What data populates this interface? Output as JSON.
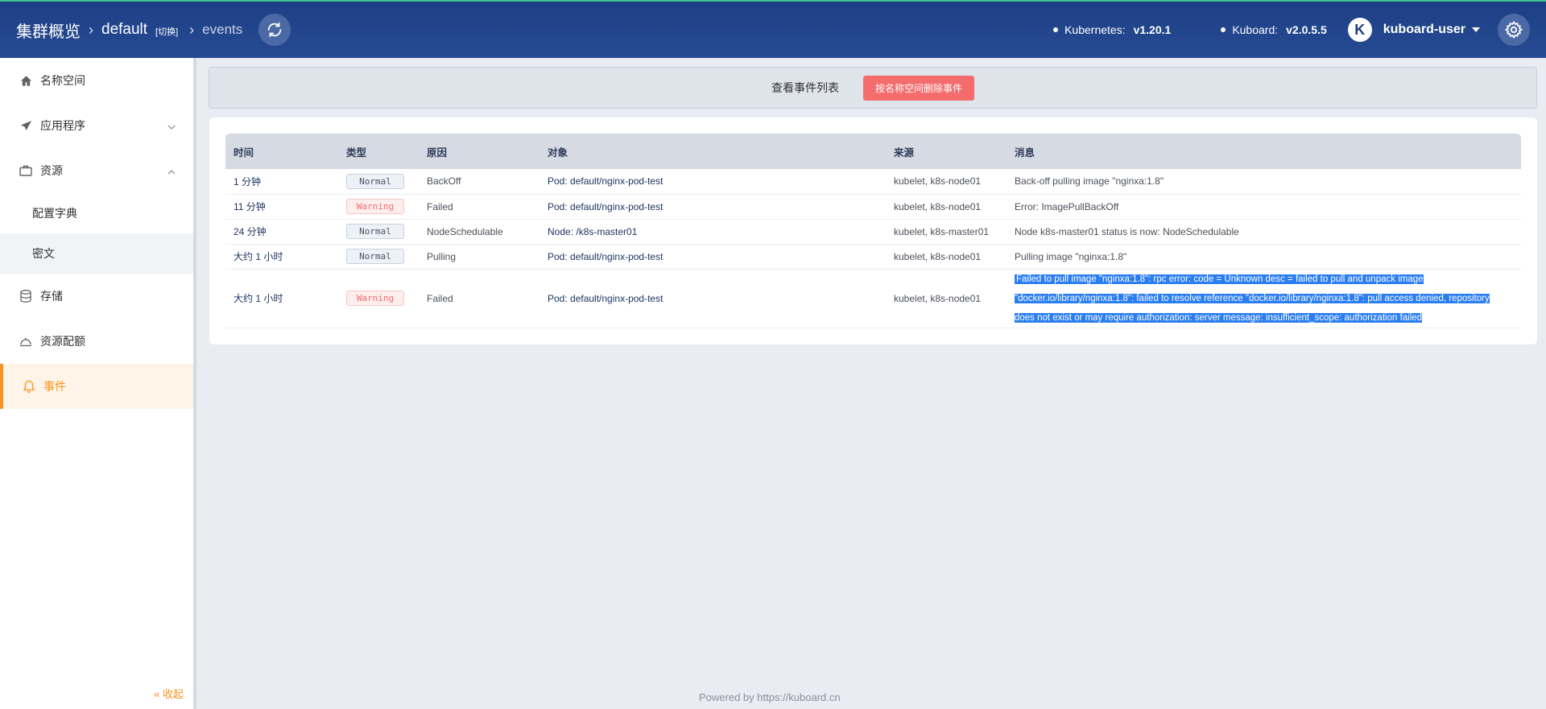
{
  "header": {
    "home": "集群概览",
    "namespace": "default",
    "switch": "[切换]",
    "page": "events",
    "kubernetes_label": "Kubernetes:",
    "kubernetes_version": "v1.20.1",
    "kuboard_label": "Kuboard:",
    "kuboard_version": "v2.0.5.5",
    "avatar_letter": "K",
    "user": "kuboard-user"
  },
  "sidebar": {
    "items": [
      {
        "label": "名称空间",
        "icon": "home-icon"
      },
      {
        "label": "应用程序",
        "icon": "send-icon"
      },
      {
        "label": "资源",
        "icon": "briefcase-icon"
      },
      {
        "label": "配置字典"
      },
      {
        "label": "密文"
      },
      {
        "label": "存储",
        "icon": "database-icon"
      },
      {
        "label": "资源配额",
        "icon": "quota-icon"
      },
      {
        "label": "事件",
        "icon": "bell-icon"
      }
    ],
    "collapse": "« 收起"
  },
  "toolbar": {
    "title": "查看事件列表",
    "delete_button": "按名称空间删除事件"
  },
  "table": {
    "columns": [
      "时间",
      "类型",
      "原因",
      "对象",
      "来源",
      "消息"
    ],
    "rows": [
      {
        "time": "1 分钟",
        "type": "Normal",
        "reason": "BackOff",
        "object": "Pod: default/nginx-pod-test",
        "source": "kubelet, k8s-node01",
        "message": "Back-off pulling image \"nginxa:1.8\""
      },
      {
        "time": "11 分钟",
        "type": "Warning",
        "reason": "Failed",
        "object": "Pod: default/nginx-pod-test",
        "source": "kubelet, k8s-node01",
        "message": "Error: ImagePullBackOff"
      },
      {
        "time": "24 分钟",
        "type": "Normal",
        "reason": "NodeSchedulable",
        "object": "Node: /k8s-master01",
        "source": "kubelet, k8s-master01",
        "message": "Node k8s-master01 status is now: NodeSchedulable"
      },
      {
        "time": "大约 1 小时",
        "type": "Normal",
        "reason": "Pulling",
        "object": "Pod: default/nginx-pod-test",
        "source": "kubelet, k8s-node01",
        "message": "Pulling image \"nginxa:1.8\""
      },
      {
        "time": "大约 1 小时",
        "type": "Warning",
        "reason": "Failed",
        "object": "Pod: default/nginx-pod-test",
        "source": "kubelet, k8s-node01",
        "message": "Failed to pull image \"nginxa:1.8\": rpc error: code = Unknown desc = failed to pull and unpack image \"docker.io/library/nginxa:1.8\": failed to resolve reference \"docker.io/library/nginxa:1.8\": pull access denied, repository does not exist or may require authorization: server message: insufficient_scope: authorization failed"
      }
    ]
  },
  "footer": {
    "powered_by": "Powered by",
    "link": "https://kuboard.cn"
  },
  "colors": {
    "header_bg": "#1c3f86",
    "accent": "#f7931e",
    "danger": "#f56c6c",
    "selection": "#2b7ef0"
  }
}
